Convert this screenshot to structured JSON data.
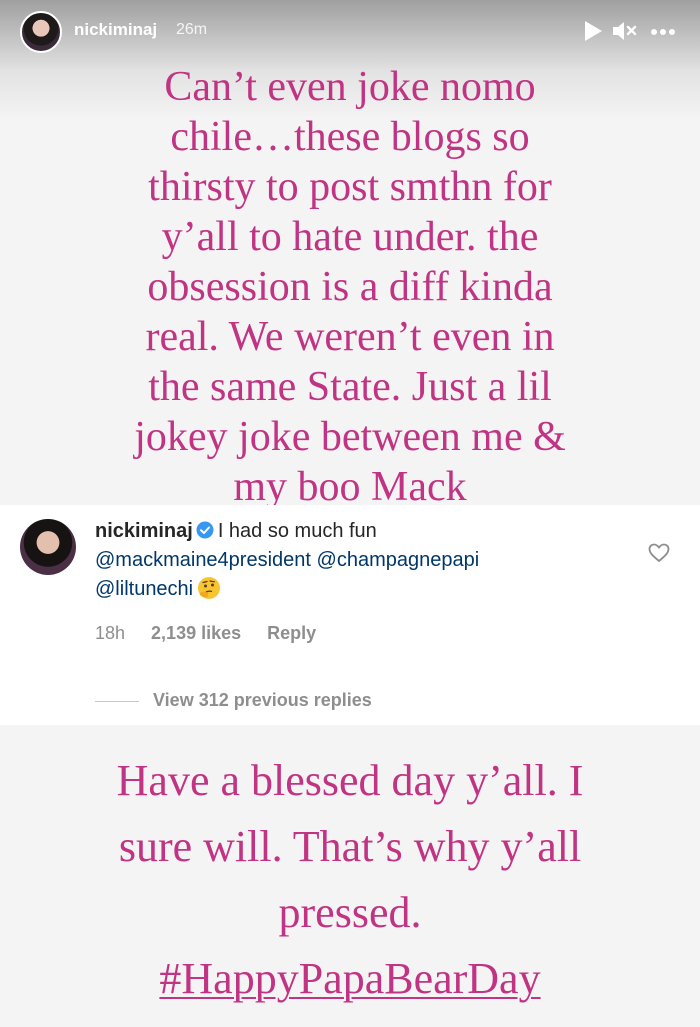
{
  "header": {
    "username": "nickiminaj",
    "time": "26m",
    "icons": [
      "play-icon",
      "mute-icon",
      "more-icon"
    ]
  },
  "caption_top": {
    "lines": [
      "Can’t even joke nomo",
      "chile…these blogs so",
      "thirsty to post smthn for",
      "y’all to hate under. the",
      "obsession is a diff kinda",
      "real. We weren’t even in",
      "the same State. Just a lil",
      "jokey joke between me &",
      "my boo Mack"
    ]
  },
  "comment": {
    "username": "nickiminaj",
    "text": "I had so much fun",
    "mentions": [
      "@mackmaine4president",
      "@champagnepapi",
      "@liltunechi"
    ],
    "time": "18h",
    "likes": "2,139 likes",
    "reply_label": "Reply",
    "view_replies": "View 312 previous replies"
  },
  "caption_bottom": {
    "lines": [
      "Have a blessed day y’all. I",
      "sure will. That’s why y’all",
      "pressed."
    ],
    "hashtag": "#HappyPapaBearDay"
  },
  "colors": {
    "caption": "#c03483",
    "mention": "#00376b",
    "meta": "#8e8e8e",
    "verified": "#3897f0"
  }
}
